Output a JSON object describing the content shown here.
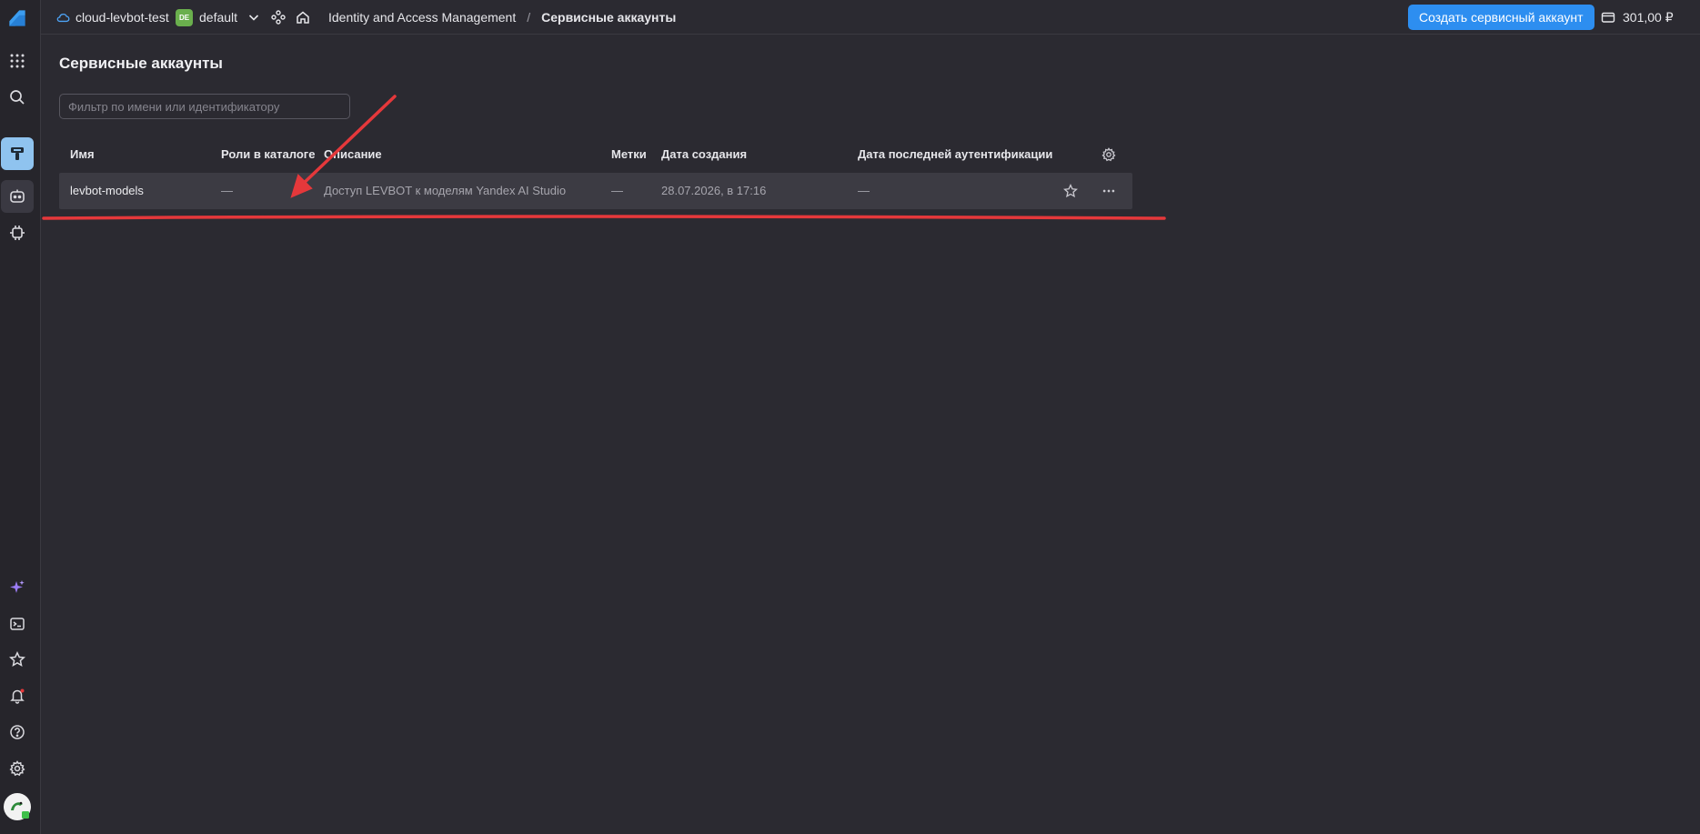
{
  "colors": {
    "background": "#2b2a31",
    "rail": "#26252b",
    "accent": "#2d8ef0",
    "row_highlight": "#3c3b43",
    "annotation": "#e5383b",
    "badge": "#6aaf4d"
  },
  "rail": {
    "items": [
      {
        "name": "logo-icon"
      },
      {
        "name": "apps-grid-icon"
      },
      {
        "name": "search-icon"
      },
      {
        "name": "iam-icon"
      },
      {
        "name": "service-account-icon"
      },
      {
        "name": "plugin-icon"
      },
      {
        "name": "sparkle-icon"
      },
      {
        "name": "terminal-icon"
      },
      {
        "name": "star-icon"
      },
      {
        "name": "bell-icon"
      },
      {
        "name": "help-icon"
      },
      {
        "name": "gear-icon"
      },
      {
        "name": "avatar"
      }
    ]
  },
  "header": {
    "cloud_name": "cloud-levbot-test",
    "folder_badge": "DE",
    "folder_name": "default",
    "breadcrumb": {
      "service": "Identity and Access Management",
      "separator": "/",
      "current": "Сервисные аккаунты"
    },
    "create_button": "Создать сервисный аккаунт",
    "balance": "301,00 ₽"
  },
  "main": {
    "title": "Сервисные аккаунты",
    "filter": {
      "placeholder": "Фильтр по имени или идентификатору",
      "value": ""
    },
    "table": {
      "columns": [
        "Имя",
        "Роли в каталоге",
        "Описание",
        "Метки",
        "Дата создания",
        "Дата последней аутентификации"
      ],
      "rows": [
        {
          "name": "levbot-models",
          "roles": "—",
          "description": "Доступ LEVBOT к моделям Yandex AI Studio",
          "labels": "—",
          "created": "28.07.2026, в 17:16",
          "last_auth": "—"
        }
      ]
    }
  }
}
